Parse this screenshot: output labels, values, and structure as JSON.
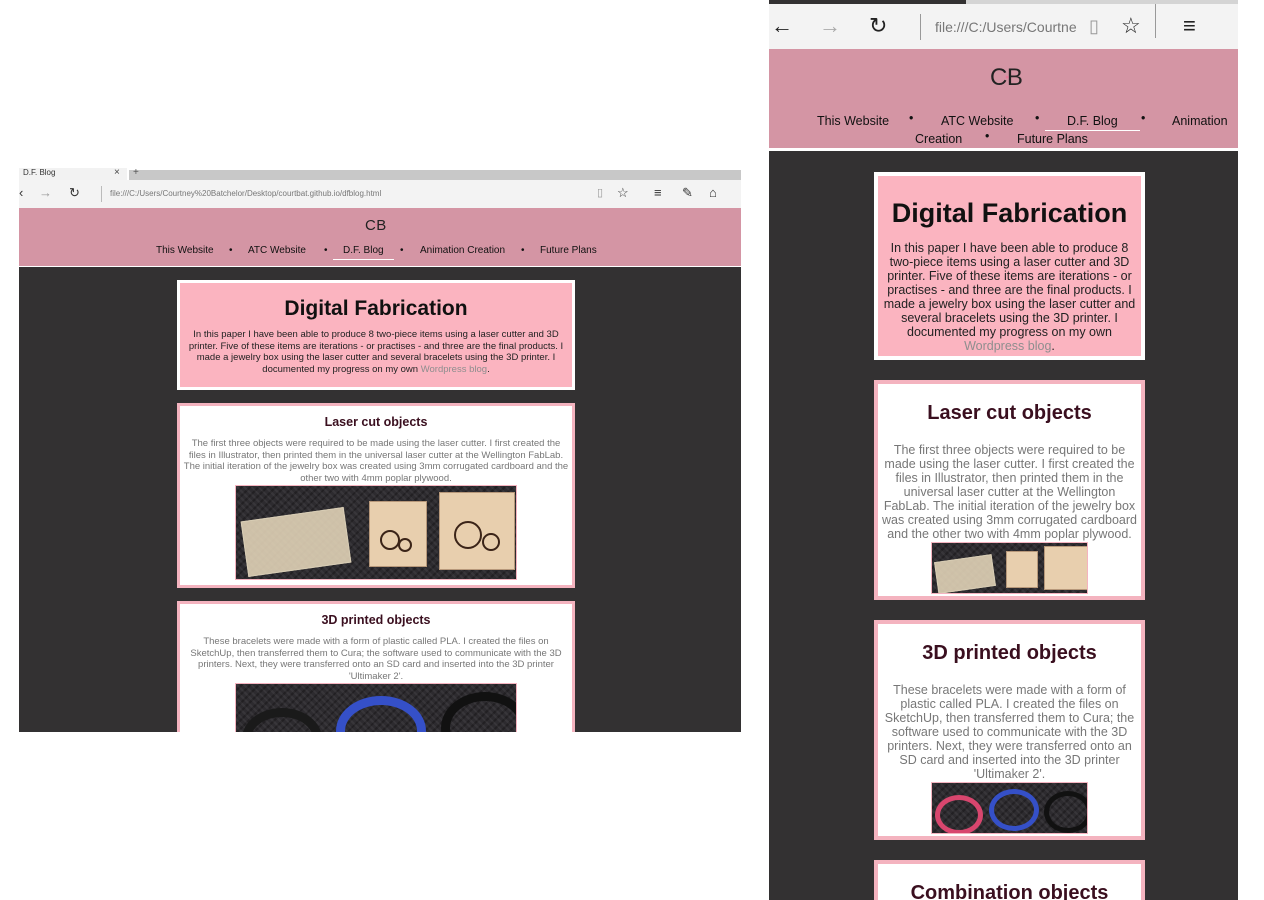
{
  "desktop": {
    "tab_title": "D.F. Blog",
    "tab_close": "×",
    "new_tab": "+",
    "url": "file:///C:/Users/Courtney%20Batchelor/Desktop/courtbat.github.io/dfblog.html",
    "icons": [
      "back-icon",
      "forward-icon",
      "refresh-icon",
      "reading-view-icon",
      "favorite-star-icon",
      "hub-icon",
      "web-note-icon",
      "share-icon"
    ]
  },
  "mobile": {
    "url": "file:///C:/Users/Courtne",
    "icons": [
      "back-icon",
      "forward-icon",
      "refresh-icon",
      "reading-view-icon",
      "favorite-star-icon",
      "menu-icon"
    ]
  },
  "site": {
    "logo": {
      "left": "C",
      "right": "B",
      "dot": "•"
    },
    "nav": [
      "This Website",
      "ATC Website",
      "D.F. Blog",
      "Animation Creation",
      "Future Plans"
    ],
    "nav_mobile_wrap": [
      "Animation",
      "Creation"
    ],
    "nav_separator": "•",
    "active_nav": "D.F. Blog",
    "intro": {
      "title": "Digital Fabrication",
      "text": "In this paper I have been able to produce 8 two-piece items using a laser cutter and 3D printer. Five of these items are iterations - or practises - and three are the final products. I made a jewelry box using the laser cutter and several bracelets using the 3D printer. I documented my progress on my own ",
      "link": "Wordpress blog",
      "end": "."
    },
    "sections": [
      {
        "title": "Laser cut objects",
        "text": "The first three objects were required to be made using the laser cutter. I first created the files in Illustrator, then printed them in the universal laser cutter at the Wellington FabLab. The initial iteration of the jewelry box was created using 3mm corrugated cardboard and the other two with 4mm poplar plywood."
      },
      {
        "title": "3D printed objects",
        "text": "These bracelets were made with a form of plastic called PLA. I created the files on SketchUp, then transferred them to Cura; the software used to communicate with the 3D printers. Next, they were transferred onto an SD card and inserted into the 3D printer 'Ultimaker 2'."
      },
      {
        "title": "Combination objects",
        "text": ""
      }
    ]
  },
  "colors": {
    "header_pink": "#d495a4",
    "card_pink": "#fbb4c0",
    "border_pink": "#f4b3bf",
    "page_dark": "#333132",
    "heading_maroon": "#3a0f1f",
    "link_gray": "#8e8e8e"
  }
}
